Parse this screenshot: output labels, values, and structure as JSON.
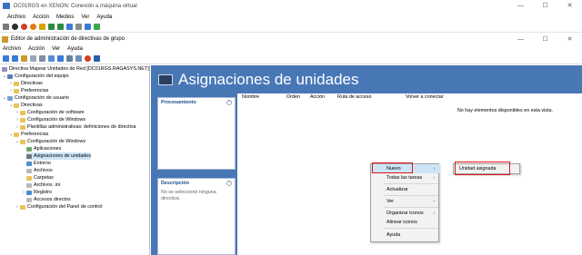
{
  "vm_window": {
    "title": "DC01RGS en XENON: Conexión a máquina virtual",
    "menu": [
      "Archivo",
      "Acción",
      "Medios",
      "Ver",
      "Ayuda"
    ],
    "controls": {
      "minimize": "—",
      "maximize": "☐",
      "close": "✕"
    }
  },
  "app_window": {
    "title": "Editor de administración de directivas de grupo",
    "menu": [
      "Archivo",
      "Acción",
      "Ver",
      "Ayuda"
    ],
    "controls": {
      "minimize": "—",
      "maximize": "☐",
      "close": "✕"
    }
  },
  "tree": {
    "root": "Directiva Mapear Unidades de Red [DC01RGS.RAGASYS.NET]",
    "computer_config": "Configuración del equipo",
    "cc_directivas": "Directivas",
    "cc_preferencias": "Preferencias",
    "user_config": "Configuración de usuario",
    "uc_directivas": "Directivas",
    "uc_software": "Configuración de software",
    "uc_windows": "Configuración de Windows",
    "uc_plantillas": "Plantillas administrativas: definiciones de directiva",
    "uc_preferencias": "Preferencias",
    "pref_windows": "Configuración de Windows",
    "aplicaciones": "Aplicaciones",
    "asignaciones": "Asignaciones de unidades",
    "entorno": "Entorno",
    "archivos": "Archivos",
    "carpetas": "Carpetas",
    "archivos_ini": "Archivos .ini",
    "registro": "Registro",
    "accesos": "Accesos directos",
    "panel_control": "Configuración del Panel de control"
  },
  "main": {
    "banner_title": "Asignaciones de unidades",
    "processing_header": "Procesamiento",
    "description_header": "Descripción",
    "description_text": "No se seleccionó ninguna directiva.",
    "columns": [
      "Nombre",
      "Orden",
      "Acción",
      "Ruta de acceso",
      "Volver a conectar"
    ],
    "empty_message": "No hay elementos disponibles en esta vista."
  },
  "context_menu": {
    "nuevo": "Nuevo",
    "todas_tareas": "Todas las tareas",
    "actualizar": "Actualizar",
    "ver": "Ver",
    "organizar": "Organizar iconos",
    "alinear": "Alinear iconos",
    "ayuda": "Ayuda"
  },
  "submenu": {
    "unidad_asignada": "Unidad asignada"
  },
  "colors": {
    "banner": "#4877b6",
    "highlight": "#e0141e",
    "selection": "#cce4f7"
  }
}
